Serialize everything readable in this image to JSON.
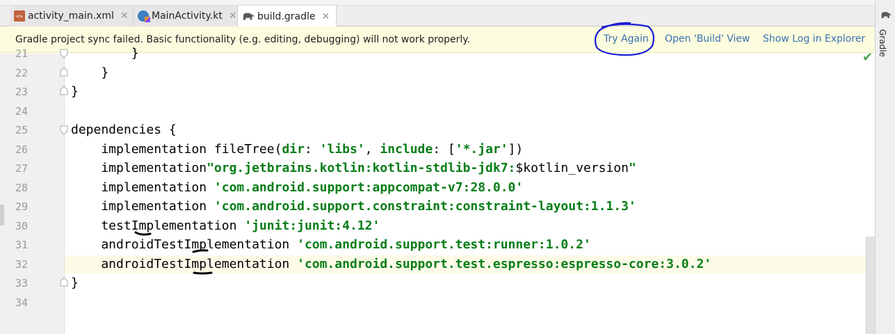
{
  "tabs": [
    {
      "label": "activity_main.xml",
      "close": "✕"
    },
    {
      "label": "MainActivity.kt",
      "close": "✕"
    },
    {
      "label": "build.gradle",
      "close": "✕"
    }
  ],
  "notification": {
    "message": "Gradle project sync failed. Basic functionality (e.g. editing, debugging) will not work properly.",
    "try_again": "Try Again",
    "open_build": "Open 'Build' View",
    "show_log": "Show Log in Explorer"
  },
  "side_panel": {
    "label": "Gradle"
  },
  "editor": {
    "line_numbers": [
      "21",
      "22",
      "23",
      "24",
      "25",
      "26",
      "27",
      "28",
      "29",
      "30",
      "31",
      "32",
      "33",
      "34"
    ],
    "lines": {
      "l21": "        }",
      "l22": "    }",
      "l23": "}",
      "l25": "dependencies {",
      "l26a": "    implementation fileTree(",
      "l26b": "dir",
      "l26c": ": ",
      "l26d": "'libs'",
      "l26e": ", ",
      "l26f": "include",
      "l26g": ": [",
      "l26h": "'*.jar'",
      "l26i": "])",
      "l27a": "    implementation",
      "l27b": "\"org.jetbrains.kotlin:kotlin-stdlib-jdk7:",
      "l27c": "$kotlin_version",
      "l27d": "\"",
      "l28a": "    implementation ",
      "l28b": "'com.android.support:appcompat-v7:28.0.0'",
      "l29a": "    implementation ",
      "l29b": "'com.android.support.constraint:constraint-layout:1.1.3'",
      "l30a": "    testImplementation ",
      "l30b": "'junit:junit:4.12'",
      "l31a": "    androidTestImplementation ",
      "l31b": "'com.android.support.test:runner:1.0.2'",
      "l32a": "    androidTestImplementation ",
      "l32b": "'com.android.support.test.espresso:espresso-core:3.0.2'",
      "l33": "}"
    }
  },
  "colors": {
    "string": "#067d17",
    "link": "#3a6fb3",
    "notice_bg": "#fcfcde",
    "annotation": "#1c1cd6"
  }
}
